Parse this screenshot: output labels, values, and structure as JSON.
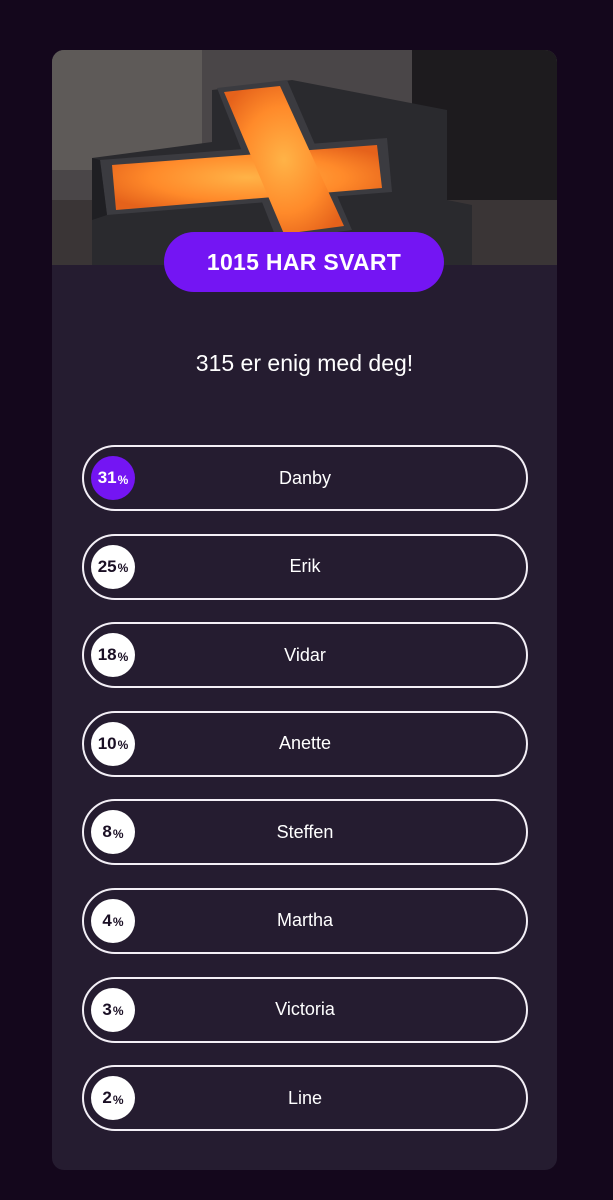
{
  "header": {
    "responses_label": "1015 HAR SVART"
  },
  "agreement_text": "315 er enig med deg!",
  "hero_image": {
    "subject": "glowing cross-shaped lamp"
  },
  "colors": {
    "accent": "#7415f3",
    "card": "#251c30",
    "background": "#14071c"
  },
  "options": [
    {
      "name": "Danby",
      "percent": "31",
      "selected": true
    },
    {
      "name": "Erik",
      "percent": "25",
      "selected": false
    },
    {
      "name": "Vidar",
      "percent": "18",
      "selected": false
    },
    {
      "name": "Anette",
      "percent": "10",
      "selected": false
    },
    {
      "name": "Steffen",
      "percent": "8",
      "selected": false
    },
    {
      "name": "Martha",
      "percent": "4",
      "selected": false
    },
    {
      "name": "Victoria",
      "percent": "3",
      "selected": false
    },
    {
      "name": "Line",
      "percent": "2",
      "selected": false
    }
  ],
  "percent_symbol": "%"
}
